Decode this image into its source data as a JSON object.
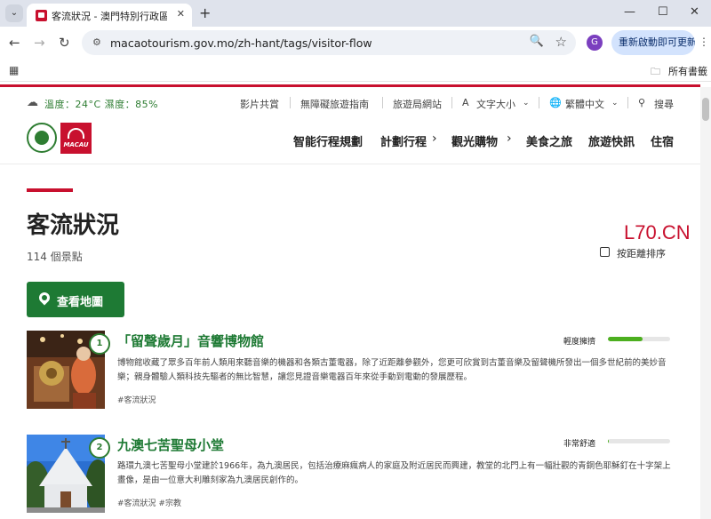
{
  "browser": {
    "tab_title": "客流狀況 - 澳門特別行政區政府旅遊局",
    "url": "macaotourism.gov.mo/zh-hant/tags/visitor-flow",
    "profile_initial": "G",
    "relaunch_label": "重新啟動即可更新",
    "bookmarks_label": "所有書籤",
    "icons": [
      "tab-search-icon",
      "favicon",
      "close-icon",
      "new-tab-icon",
      "minimize-icon",
      "maximize-icon",
      "close-window-icon",
      "back-icon",
      "forward-icon",
      "reload-icon",
      "site-info-icon",
      "zoom-icon",
      "star-icon",
      "menu-icon",
      "apps-icon",
      "folder-icon"
    ]
  },
  "site": {
    "weather": "溫度：24°C  濕度：85%",
    "utility_links": [
      "影片共賞",
      "無障礙旅遊指南",
      "旅遊局網站"
    ],
    "font_size_label": "文字大小",
    "language_label": "繁體中文",
    "search_label": "搜尋",
    "main_nav": [
      "智能行程規劃",
      "計劃行程",
      "觀光購物",
      "美食之旅",
      "旅遊快訊",
      "住宿"
    ],
    "brand_text": "MACAU",
    "accent_color": "#c8102e",
    "green_color": "#1e7a34"
  },
  "page": {
    "title": "客流狀況",
    "count": "114 個景點",
    "watermark": "L70.CN",
    "sort_label": "按距離排序",
    "map_button": "查看地圖"
  },
  "cards": [
    {
      "number": "1",
      "title": "「留聲歲月」音響博物館",
      "description": "博物館收藏了眾多百年前人類用來聽音樂的機器和各類古董電器，除了近距離參觀外，您更可欣賞到古董音樂及留聲機所發出一個多世紀前的美妙音樂；親身體驗人類科技先驅者的無比智慧，讓您見證音樂電器百年來從手動到電動的發展歷程。",
      "tags": "#客流狀況",
      "crowd_label": "輕度擁擠",
      "crowd_level": 0.55
    },
    {
      "number": "2",
      "title": "九澳七苦聖母小堂",
      "description": "路環九澳七苦聖母小堂建於1966年，為九澳居民，包括治療麻瘋病人的家庭及附近居民而興建，教堂的北門上有一幅壯觀的青銅色耶穌釘在十字架上畫像，是由一位意大利雕刻家為九澳居民創作的。",
      "tags": "#客流狀況  #宗教",
      "crowd_label": "非常舒適",
      "crowd_level": 0.02
    }
  ]
}
